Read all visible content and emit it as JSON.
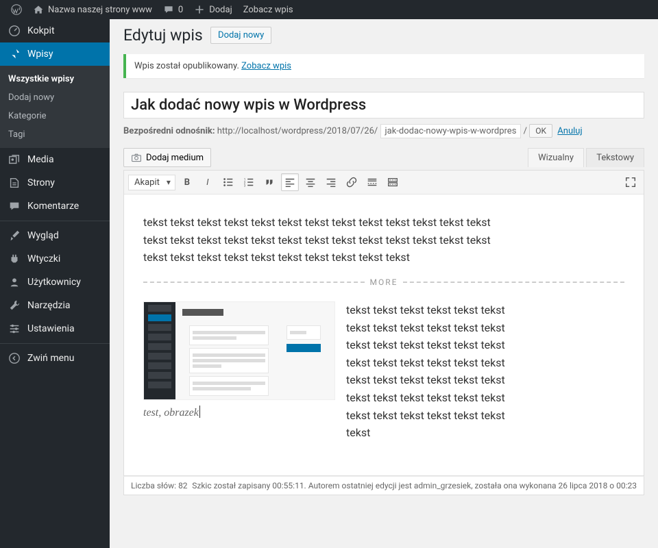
{
  "adminbar": {
    "site_name": "Nazwa naszej strony www",
    "comments_count": "0",
    "add_new": "Dodaj",
    "view_post": "Zobacz wpis"
  },
  "sidebar": {
    "items": [
      {
        "label": "Kokpit"
      },
      {
        "label": "Wpisy"
      },
      {
        "label": "Media"
      },
      {
        "label": "Strony"
      },
      {
        "label": "Komentarze"
      },
      {
        "label": "Wygląd"
      },
      {
        "label": "Wtyczki"
      },
      {
        "label": "Użytkownicy"
      },
      {
        "label": "Narzędzia"
      },
      {
        "label": "Ustawienia"
      },
      {
        "label": "Zwiń menu"
      }
    ],
    "submenu": [
      {
        "label": "Wszystkie wpisy"
      },
      {
        "label": "Dodaj nowy"
      },
      {
        "label": "Kategorie"
      },
      {
        "label": "Tagi"
      }
    ]
  },
  "page": {
    "title": "Edytuj wpis",
    "add_new_button": "Dodaj nowy"
  },
  "notice": {
    "text": "Wpis został opublikowany. ",
    "link": "Zobacz wpis"
  },
  "post": {
    "title": "Jak dodać nowy wpis w Wordpress",
    "permalink_label": "Bezpośredni odnośnik:",
    "permalink_base": "http://localhost/wordpress/2018/07/26/",
    "slug": "jak-dodac-nowy-wpis-w-wordpres",
    "permalink_sep": "/",
    "ok": "OK",
    "cancel": "Anuluj"
  },
  "editor": {
    "add_media": "Dodaj medium",
    "tab_visual": "Wizualny",
    "tab_text": "Tekstowy",
    "format_select": "Akapit",
    "more_label": "MORE",
    "p1": "tekst tekst tekst tekst tekst tekst tekst tekst tekst tekst tekst tekst tekst tekst tekst tekst tekst tekst tekst tekst tekst tekst tekst tekst tekst tekst tekst tekst tekst tekst tekst tekst tekst tekst tekst tekst",
    "p2": "tekst tekst tekst tekst tekst tekst tekst tekst tekst tekst tekst tekst tekst tekst tekst tekst tekst tekst tekst tekst tekst tekst tekst tekst tekst tekst tekst tekst tekst tekst tekst tekst tekst tekst tekst tekst tekst tekst tekst tekst tekst tekst tekst",
    "caption": "test, obrazek"
  },
  "statusbar": {
    "word_count_label": "Liczba słów:",
    "word_count": "82",
    "draft_info": "Szkic został zapisany 00:55:11. Autorem ostatniej edycji jest admin_grzesiek, została ona wykonana 26 lipca 2018 o 00:23"
  }
}
